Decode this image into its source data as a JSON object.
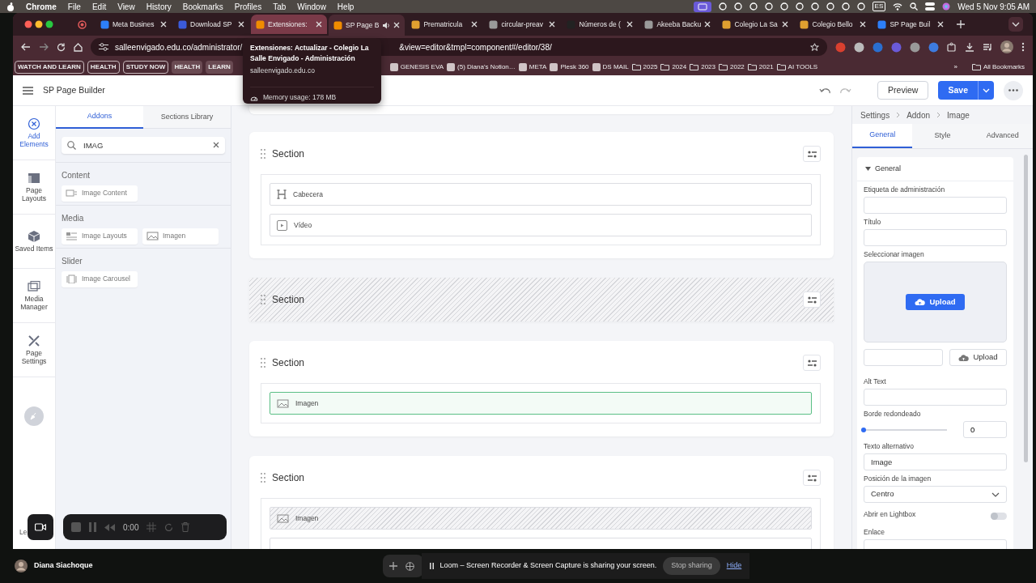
{
  "menu_bar": {
    "app": "Chrome",
    "items": [
      "File",
      "Edit",
      "View",
      "History",
      "Bookmarks",
      "Profiles",
      "Tab",
      "Window",
      "Help"
    ],
    "input_source": "ES",
    "clock": "Wed 5 Nov  9:05 AM"
  },
  "browser": {
    "tabs": [
      {
        "kind": "pinned",
        "selected": false,
        "hovered": false,
        "audio": false,
        "color": "#e05a5a"
      },
      {
        "kind": "tab",
        "title": "Meta Busines",
        "selected": false,
        "hovered": false,
        "audio": false,
        "color": "#2d7ff9"
      },
      {
        "kind": "tab",
        "title": "Download SP",
        "selected": false,
        "hovered": false,
        "audio": false,
        "color": "#3b5bdb"
      },
      {
        "kind": "tab",
        "title": "Extensiones:",
        "selected": false,
        "hovered": true,
        "audio": false,
        "color": "#f08c00"
      },
      {
        "kind": "tab",
        "title": "SP Page B",
        "selected": true,
        "hovered": false,
        "audio": true,
        "color": "#f08c00"
      },
      {
        "kind": "tab",
        "title": "Prematricula",
        "selected": false,
        "hovered": false,
        "audio": false,
        "color": "#e0a030"
      },
      {
        "kind": "tab",
        "title": "circular-preav",
        "selected": false,
        "hovered": false,
        "audio": false,
        "color": "#9a9a9a"
      },
      {
        "kind": "tab",
        "title": "Números de (",
        "selected": false,
        "hovered": false,
        "audio": false,
        "color": "#222222"
      },
      {
        "kind": "tab",
        "title": "Akeeba Backu",
        "selected": false,
        "hovered": false,
        "audio": false,
        "color": "#9a9a9a"
      },
      {
        "kind": "tab",
        "title": "Colegio La Sa",
        "selected": false,
        "hovered": false,
        "audio": false,
        "color": "#e0a030"
      },
      {
        "kind": "tab",
        "title": "Colegio Bello",
        "selected": false,
        "hovered": false,
        "audio": false,
        "color": "#e0a030"
      },
      {
        "kind": "tab",
        "title": "SP Page Buil",
        "selected": false,
        "hovered": false,
        "audio": false,
        "color": "#2d7ff9"
      }
    ],
    "url_start": "salleenvigado.edu.co/administrator/",
    "url_end": "&view=editor&tmpl=component#/editor/38/",
    "bookmarks": [
      {
        "kind": "outlined",
        "label": "WATCH AND LEARN"
      },
      {
        "kind": "outlined",
        "label": "HEALTH"
      },
      {
        "kind": "outlined",
        "label": "STUDY NOW"
      },
      {
        "kind": "filled",
        "label": "HEALTH"
      },
      {
        "kind": "filled",
        "label": "LEARN"
      },
      {
        "kind": "site",
        "label": "GENESIS EVA"
      },
      {
        "kind": "site",
        "label": "(5) Diana's Notion…"
      },
      {
        "kind": "site",
        "label": "META"
      },
      {
        "kind": "site",
        "label": "Plesk 360"
      },
      {
        "kind": "site",
        "label": "DS MAIL"
      },
      {
        "kind": "folder",
        "label": "2025"
      },
      {
        "kind": "folder",
        "label": "2024"
      },
      {
        "kind": "folder",
        "label": "2023"
      },
      {
        "kind": "folder",
        "label": "2022"
      },
      {
        "kind": "folder",
        "label": "2021"
      },
      {
        "kind": "folder",
        "label": "AI TOOLS"
      }
    ],
    "more": "»",
    "all_bookmarks": "All Bookmarks"
  },
  "tooltip": {
    "title": "Extensiones: Actualizar - Colegio La Salle Envigado - Administración",
    "host": "salleenvigado.edu.co",
    "memory": "Memory usage: 178 MB"
  },
  "builder": {
    "title": "SP Page Builder",
    "preview": "Preview",
    "save": "Save",
    "sidebar": [
      {
        "label": "Add Elements",
        "selected": true
      },
      {
        "label": "Page Layouts",
        "selected": false
      },
      {
        "label": "Saved Items",
        "selected": false
      },
      {
        "label": "Media Manager",
        "selected": false
      },
      {
        "label": "Page Settings",
        "selected": false
      }
    ],
    "sidebar_footer": "Le",
    "panel_tabs": [
      {
        "label": "Addons",
        "selected": true
      },
      {
        "label": "Sections Library",
        "selected": false
      }
    ],
    "search": {
      "value": "IMAG"
    },
    "groups": [
      {
        "name": "Content",
        "items": [
          "Image Content"
        ]
      },
      {
        "name": "Media",
        "items": [
          "Image Layouts",
          "Imagen"
        ]
      },
      {
        "name": "Slider",
        "items": [
          "Image Carousel"
        ]
      }
    ],
    "sections": [
      {
        "title": "Section",
        "disabled": false,
        "addons": [
          {
            "label": "Cabecera",
            "kind": "heading",
            "selected": false,
            "disabled": false
          },
          {
            "label": "Vídeo",
            "kind": "video",
            "selected": false,
            "disabled": false
          }
        ]
      },
      {
        "title": "Section",
        "disabled": true
      },
      {
        "title": "Section",
        "disabled": false,
        "addons": [
          {
            "label": "Imagen",
            "kind": "image",
            "selected": true,
            "disabled": false
          }
        ]
      },
      {
        "title": "Section",
        "disabled": false,
        "addons": [
          {
            "label": "Imagen",
            "kind": "image",
            "selected": false,
            "disabled": true
          }
        ]
      }
    ],
    "settings": {
      "breadcrumb": [
        "Settings",
        "Addon",
        "Image"
      ],
      "tabs": [
        {
          "label": "General",
          "selected": true
        },
        {
          "label": "Style",
          "selected": false
        },
        {
          "label": "Advanced",
          "selected": false
        }
      ],
      "group": {
        "title": "General",
        "expanded": true
      },
      "fields": [
        {
          "kind": "text",
          "label": "Etiqueta de administración"
        },
        {
          "kind": "text",
          "label": "Título"
        },
        {
          "kind": "dropzone",
          "label": "Seleccionar imagen",
          "button": "Upload"
        },
        {
          "kind": "upload_row",
          "button": "Upload"
        },
        {
          "kind": "text",
          "label": "Alt Text"
        },
        {
          "kind": "slider",
          "label": "Borde redondeado",
          "level": 0,
          "value": "0"
        },
        {
          "kind": "text",
          "label": "Texto alternativo",
          "value": "Image"
        },
        {
          "kind": "select",
          "label": "Posición de la imagen",
          "value": "Centro"
        },
        {
          "kind": "toggle",
          "label": "Abrir en Lightbox",
          "on": false
        },
        {
          "kind": "text",
          "label": "Enlace"
        }
      ]
    }
  },
  "recorder": {
    "time": "0:00"
  },
  "dock": {
    "user": "Diana Siachoque",
    "notice": "Loom – Screen Recorder & Screen Capture is sharing your screen.",
    "stop": "Stop sharing",
    "hide": "Hide"
  }
}
